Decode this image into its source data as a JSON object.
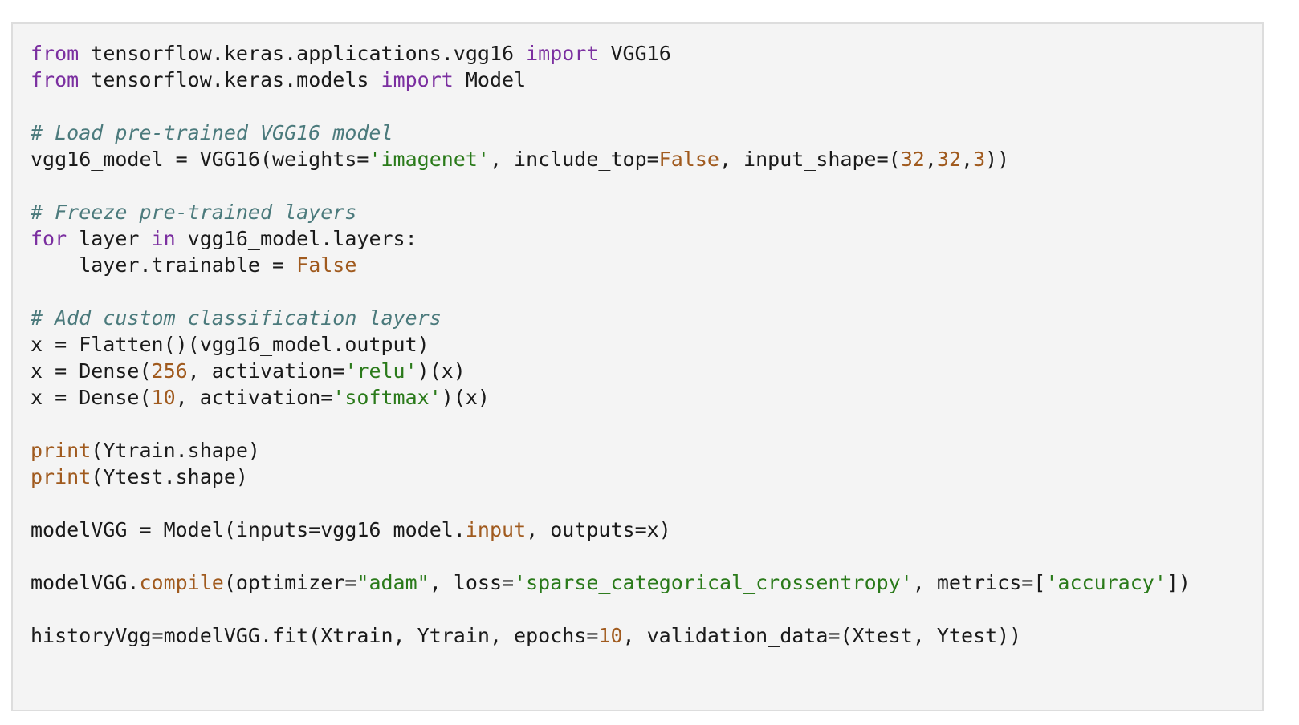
{
  "colors": {
    "background": "#f4f4f4",
    "border": "#dddddd",
    "keyword": "#7b2fa0",
    "comment": "#4b7a7c",
    "string": "#2a7a1a",
    "number": "#a05a1e",
    "builtin": "#a05a1e",
    "text": "#1a1a1a"
  },
  "code_lines": [
    [
      [
        "kw",
        "from"
      ],
      [
        "tx",
        " tensorflow.keras.applications.vgg16 "
      ],
      [
        "kw",
        "import"
      ],
      [
        "tx",
        " VGG16"
      ]
    ],
    [
      [
        "kw",
        "from"
      ],
      [
        "tx",
        " tensorflow.keras.models "
      ],
      [
        "kw",
        "import"
      ],
      [
        "tx",
        " Model"
      ]
    ],
    [],
    [
      [
        "cm",
        "# Load pre-trained VGG16 model"
      ]
    ],
    [
      [
        "tx",
        "vgg16_model = VGG16(weights="
      ],
      [
        "str",
        "'imagenet'"
      ],
      [
        "tx",
        ", include_top="
      ],
      [
        "num",
        "False"
      ],
      [
        "tx",
        ", input_shape=("
      ],
      [
        "num",
        "32"
      ],
      [
        "tx",
        ","
      ],
      [
        "num",
        "32"
      ],
      [
        "tx",
        ","
      ],
      [
        "num",
        "3"
      ],
      [
        "tx",
        "))"
      ]
    ],
    [],
    [
      [
        "cm",
        "# Freeze pre-trained layers"
      ]
    ],
    [
      [
        "kw",
        "for"
      ],
      [
        "tx",
        " layer "
      ],
      [
        "kw",
        "in"
      ],
      [
        "tx",
        " vgg16_model.layers:"
      ]
    ],
    [
      [
        "tx",
        "    layer.trainable = "
      ],
      [
        "num",
        "False"
      ]
    ],
    [],
    [
      [
        "cm",
        "# Add custom classification layers"
      ]
    ],
    [
      [
        "tx",
        "x = Flatten()(vgg16_model.output)"
      ]
    ],
    [
      [
        "tx",
        "x = Dense("
      ],
      [
        "num",
        "256"
      ],
      [
        "tx",
        ", activation="
      ],
      [
        "str",
        "'relu'"
      ],
      [
        "tx",
        ")(x)"
      ]
    ],
    [
      [
        "tx",
        "x = Dense("
      ],
      [
        "num",
        "10"
      ],
      [
        "tx",
        ", activation="
      ],
      [
        "str",
        "'softmax'"
      ],
      [
        "tx",
        ")(x)"
      ]
    ],
    [],
    [
      [
        "bi",
        "print"
      ],
      [
        "tx",
        "(Ytrain.shape)"
      ]
    ],
    [
      [
        "bi",
        "print"
      ],
      [
        "tx",
        "(Ytest.shape)"
      ]
    ],
    [],
    [
      [
        "tx",
        "modelVGG = Model(inputs=vgg16_model."
      ],
      [
        "bi",
        "input"
      ],
      [
        "tx",
        ", outputs=x)"
      ]
    ],
    [],
    [
      [
        "tx",
        "modelVGG."
      ],
      [
        "bi",
        "compile"
      ],
      [
        "tx",
        "(optimizer="
      ],
      [
        "str",
        "\"adam\""
      ],
      [
        "tx",
        ", loss="
      ],
      [
        "str",
        "'sparse_categorical_crossentropy'"
      ],
      [
        "tx",
        ", metrics=["
      ],
      [
        "str",
        "'accuracy'"
      ],
      [
        "tx",
        "])"
      ]
    ],
    [],
    [
      [
        "tx",
        "historyVgg=modelVGG.fit(Xtrain, Ytrain, epochs="
      ],
      [
        "num",
        "10"
      ],
      [
        "tx",
        ", validation_data=(Xtest, Ytest))"
      ]
    ]
  ]
}
